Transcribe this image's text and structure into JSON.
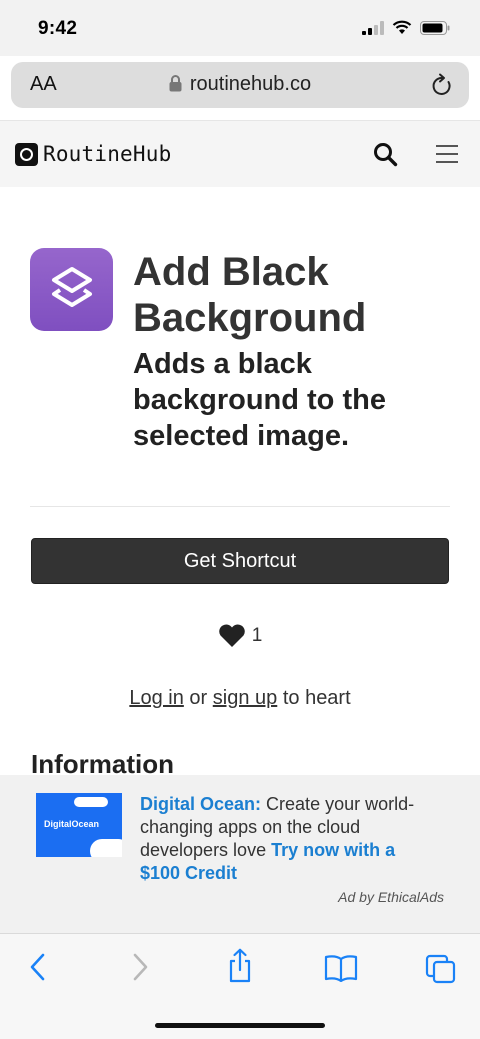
{
  "status_bar": {
    "time": "9:42"
  },
  "browser": {
    "text_size_label": "AA",
    "url": "routinehub.co"
  },
  "site": {
    "brand": "RoutineHub"
  },
  "shortcut": {
    "title": "Add Black Background",
    "subtitle": "Adds a black background to the selected image.",
    "get_button_label": "Get Shortcut",
    "heart_count": "1",
    "login_link": "Log in",
    "or_text": "or",
    "signup_link": "sign up",
    "heart_suffix": "to heart",
    "info_heading": "Information"
  },
  "ad": {
    "image_label": "DigitalOcean",
    "brand": "Digital Ocean:",
    "body": "Create your world-changing apps on the cloud developers love",
    "cta": "Try now with a $100 Credit",
    "attribution": "Ad by EthicalAds"
  },
  "colors": {
    "accent_link": "#1b7fd1",
    "button_dark": "#333333",
    "app_icon": "#8a59c6",
    "safari_blue": "#1a82f7"
  }
}
